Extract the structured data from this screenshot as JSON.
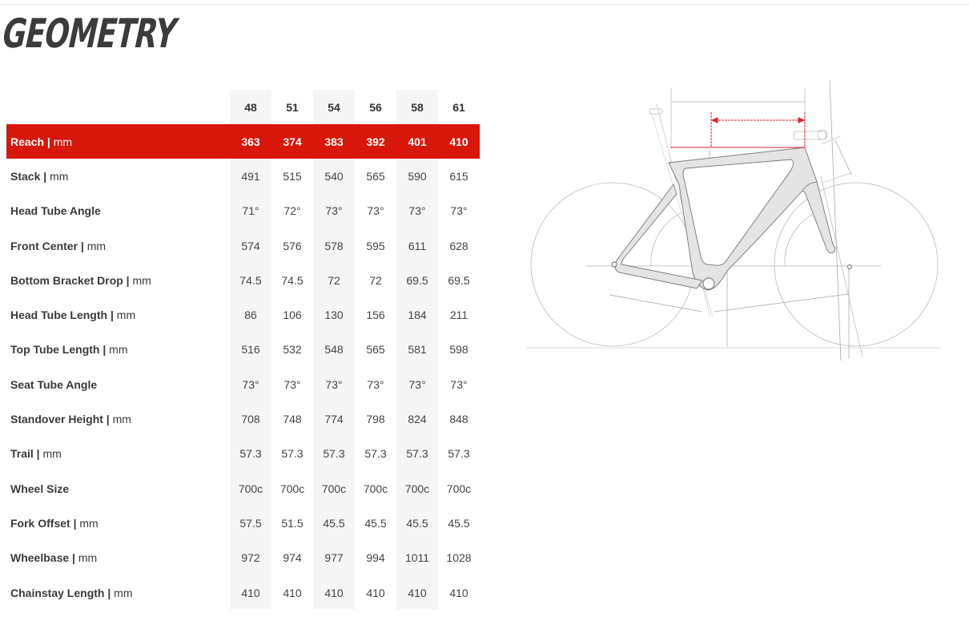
{
  "page": {
    "title": "GEOMETRY"
  },
  "table": {
    "sizes": [
      "48",
      "51",
      "54",
      "56",
      "58",
      "61"
    ],
    "highlight_color": "#d9160a",
    "rows": [
      {
        "label": "Reach",
        "unit": "mm",
        "values": [
          "363",
          "374",
          "383",
          "392",
          "401",
          "410"
        ],
        "highlighted": true
      },
      {
        "label": "Stack",
        "unit": "mm",
        "values": [
          "491",
          "515",
          "540",
          "565",
          "590",
          "615"
        ]
      },
      {
        "label": "Head Tube Angle",
        "unit": "",
        "values": [
          "71°",
          "72°",
          "73°",
          "73°",
          "73°",
          "73°"
        ]
      },
      {
        "label": "Front Center",
        "unit": "mm",
        "values": [
          "574",
          "576",
          "578",
          "595",
          "611",
          "628"
        ]
      },
      {
        "label": "Bottom Bracket Drop",
        "unit": "mm",
        "values": [
          "74.5",
          "74.5",
          "72",
          "72",
          "69.5",
          "69.5"
        ]
      },
      {
        "label": "Head Tube Length",
        "unit": "mm",
        "values": [
          "86",
          "106",
          "130",
          "156",
          "184",
          "211"
        ]
      },
      {
        "label": "Top Tube Length",
        "unit": "mm",
        "values": [
          "516",
          "532",
          "548",
          "565",
          "581",
          "598"
        ]
      },
      {
        "label": "Seat Tube Angle",
        "unit": "",
        "values": [
          "73°",
          "73°",
          "73°",
          "73°",
          "73°",
          "73°"
        ]
      },
      {
        "label": "Standover Height",
        "unit": "mm",
        "values": [
          "708",
          "748",
          "774",
          "798",
          "824",
          "848"
        ]
      },
      {
        "label": "Trail",
        "unit": "mm",
        "values": [
          "57.3",
          "57.3",
          "57.3",
          "57.3",
          "57.3",
          "57.3"
        ]
      },
      {
        "label": "Wheel Size",
        "unit": "",
        "values": [
          "700c",
          "700c",
          "700c",
          "700c",
          "700c",
          "700c"
        ]
      },
      {
        "label": "Fork Offset",
        "unit": "mm",
        "values": [
          "57.5",
          "51.5",
          "45.5",
          "45.5",
          "45.5",
          "45.5"
        ]
      },
      {
        "label": "Wheelbase",
        "unit": "mm",
        "values": [
          "972",
          "974",
          "977",
          "994",
          "1011",
          "1028"
        ]
      },
      {
        "label": "Chainstay Length",
        "unit": "mm",
        "values": [
          "410",
          "410",
          "410",
          "410",
          "410",
          "410"
        ]
      }
    ]
  },
  "diagram": {
    "name": "bike-frame-geometry-diagram",
    "highlighted_measure": "Reach"
  }
}
